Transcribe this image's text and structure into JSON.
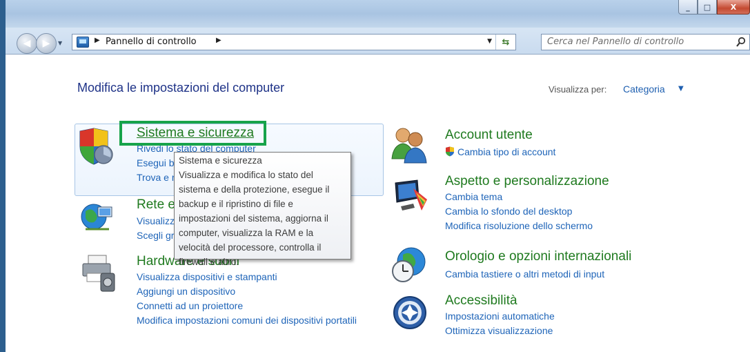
{
  "window": {
    "caption_buttons": [
      "_",
      "□",
      "X"
    ]
  },
  "address": {
    "breadcrumb": "Pannello di controllo",
    "search_placeholder": "Cerca nel Pannello di controllo"
  },
  "page": {
    "title": "Modifica le impostazioni del computer",
    "view_by_label": "Visualizza per:",
    "view_by_value": "Categoria"
  },
  "left_categories": [
    {
      "heading": "Sistema e sicurezza",
      "links": [
        "Rivedi lo stato del computer",
        "Esegui b",
        "Trova e r"
      ],
      "icon": "shield-icon"
    },
    {
      "heading": "Rete e",
      "links": [
        "Visualizz",
        "Scegli gr"
      ],
      "icon": "network-globe-icon"
    },
    {
      "heading": "Hardware e suoni",
      "links": [
        "Visualizza dispositivi e stampanti",
        "Aggiungi un dispositivo",
        "Connetti ad un proiettore",
        "Modifica impostazioni comuni dei dispositivi portatili"
      ],
      "icon": "printer-icon"
    }
  ],
  "right_categories": [
    {
      "heading": "Account utente",
      "links": [
        "Cambia tipo di account"
      ],
      "icon": "users-icon"
    },
    {
      "heading": "Aspetto e personalizzazione",
      "links": [
        "Cambia tema",
        "Cambia lo sfondo del desktop",
        "Modifica risoluzione dello schermo"
      ],
      "icon": "monitor-palette-icon"
    },
    {
      "heading": "Orologio e opzioni internazionali",
      "links": [
        "Cambia tastiere o altri metodi di input"
      ],
      "icon": "clock-globe-icon"
    },
    {
      "heading": "Accessibilità",
      "links": [
        "Impostazioni automatiche",
        "Ottimizza visualizzazione"
      ],
      "icon": "accessibility-icon"
    }
  ],
  "tooltip": {
    "title": "Sistema e sicurezza",
    "body": "Visualizza e modifica lo stato del sistema e della protezione, esegue il backup e il ripristino di file e impostazioni del sistema, aggiorna il computer, visualizza la RAM e la velocità del processore, controlla il firewall e altro."
  },
  "colors": {
    "heading_green": "#1f7a1f",
    "link_blue": "#1e64b8",
    "highlight_green": "#17a34a"
  }
}
